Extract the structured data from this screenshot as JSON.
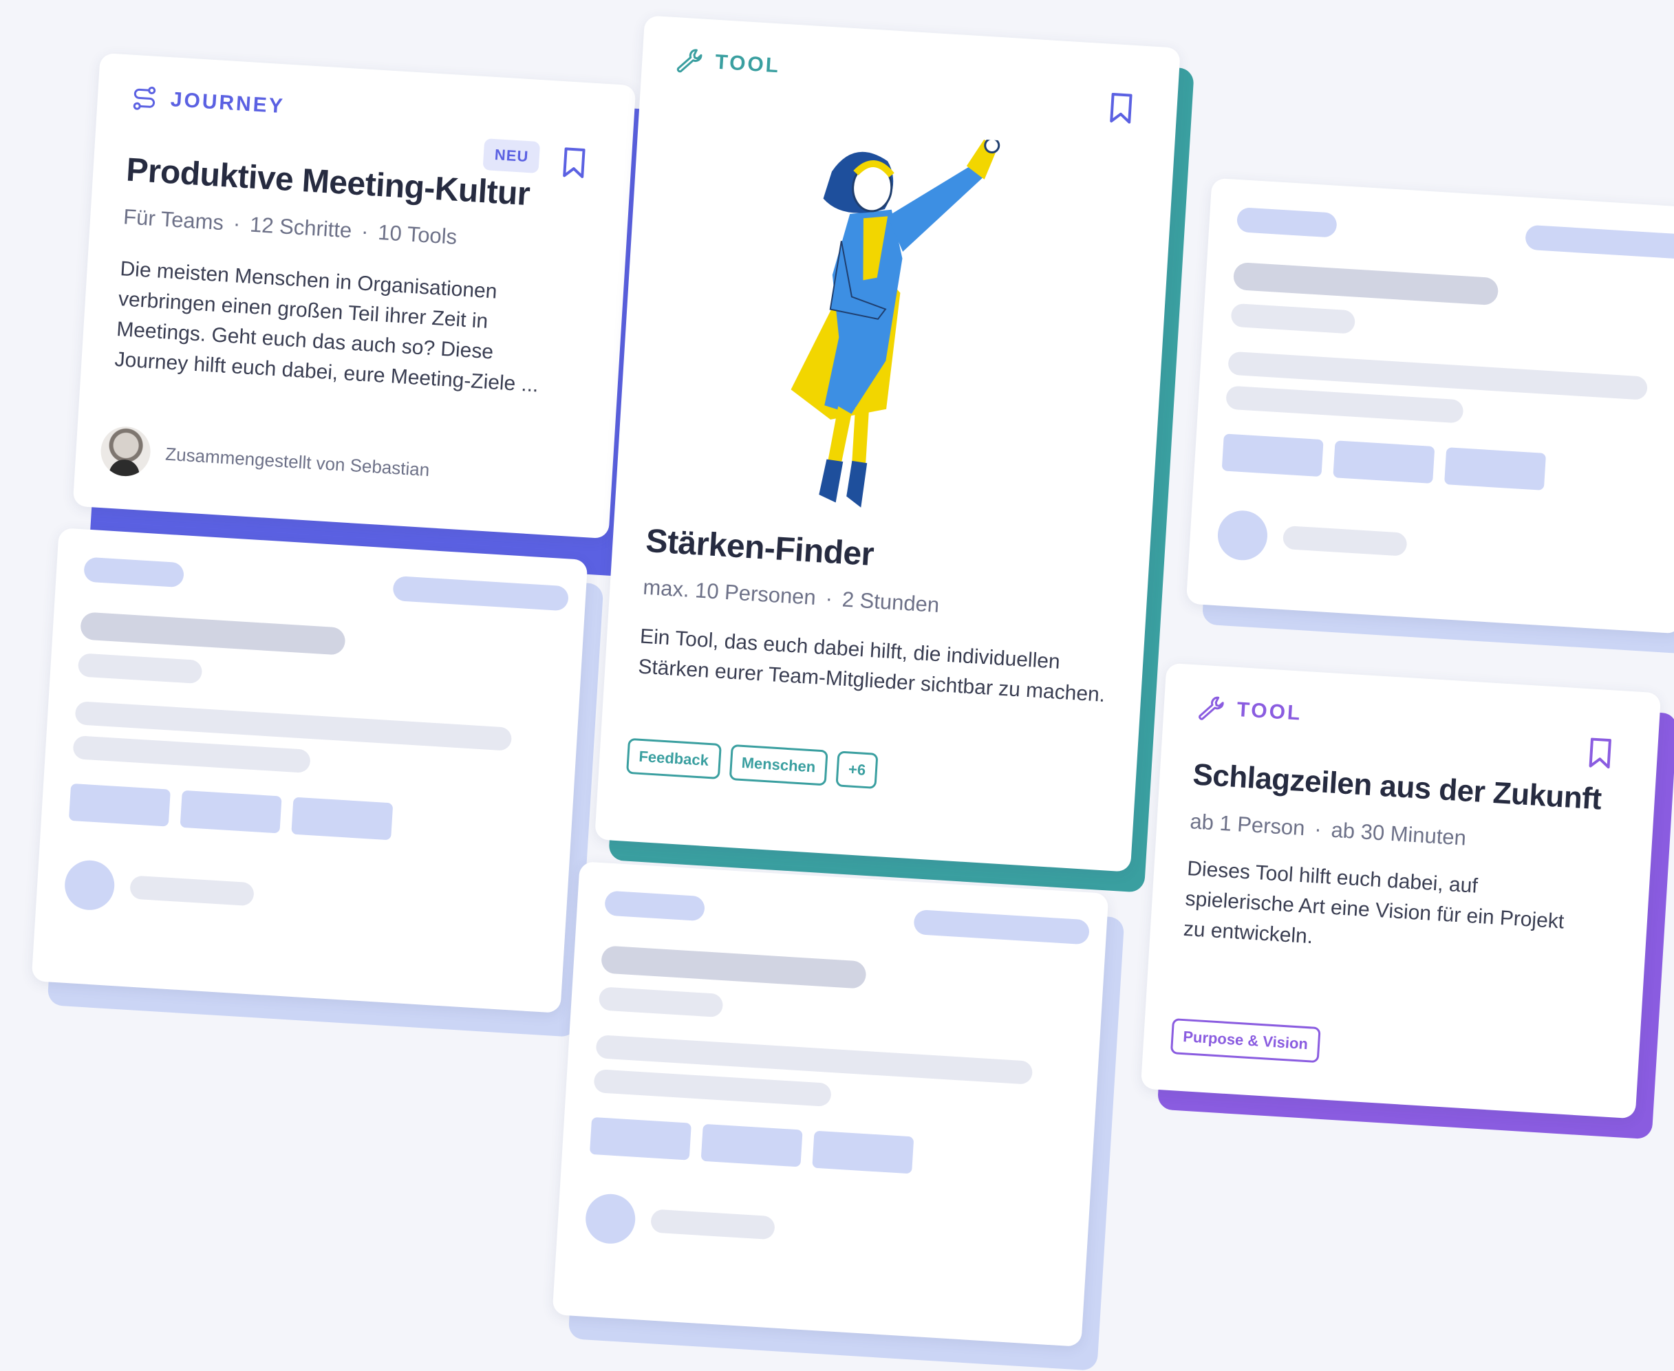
{
  "colors": {
    "journey": "#5b61e2",
    "tool_teal": "#3a9fa0",
    "tool_purple": "#8a5ce0",
    "skeleton_slab": "#cbd5f5"
  },
  "journey_card": {
    "kind_icon": "route-icon",
    "kind_label": "JOURNEY",
    "badge": "NEU",
    "title": "Produktive Meeting-Kultur",
    "meta": [
      "Für Teams",
      "12 Schritte",
      "10 Tools"
    ],
    "description": "Die meisten Menschen in Organisationen verbringen einen großen Teil ihrer Zeit in Meetings. Geht euch das auch so? Diese Journey hilft euch dabei, eure Meeting-Ziele ...",
    "author": "Zusammengestellt von Sebastian"
  },
  "staerken_card": {
    "kind_icon": "wrench-icon",
    "kind_label": "TOOL",
    "title": "Stärken-Finder",
    "meta": [
      "max. 10 Personen",
      "2 Stunden"
    ],
    "description": "Ein Tool, das euch dabei hilft, die individuellen Stärken eurer Team-Mitglieder sichtbar zu machen.",
    "tags": [
      "Feedback",
      "Menschen",
      "+6"
    ]
  },
  "schlagzeilen_card": {
    "kind_icon": "wrench-icon",
    "kind_label": "TOOL",
    "title": "Schlagzeilen aus der Zukunft",
    "meta": [
      "ab 1 Person",
      "ab 30 Minuten"
    ],
    "description": "Dieses Tool hilft euch dabei, auf spielerische Art eine Vision für ein Projekt zu entwickeln.",
    "tags": [
      "Purpose & Vision"
    ]
  },
  "separator": "·"
}
